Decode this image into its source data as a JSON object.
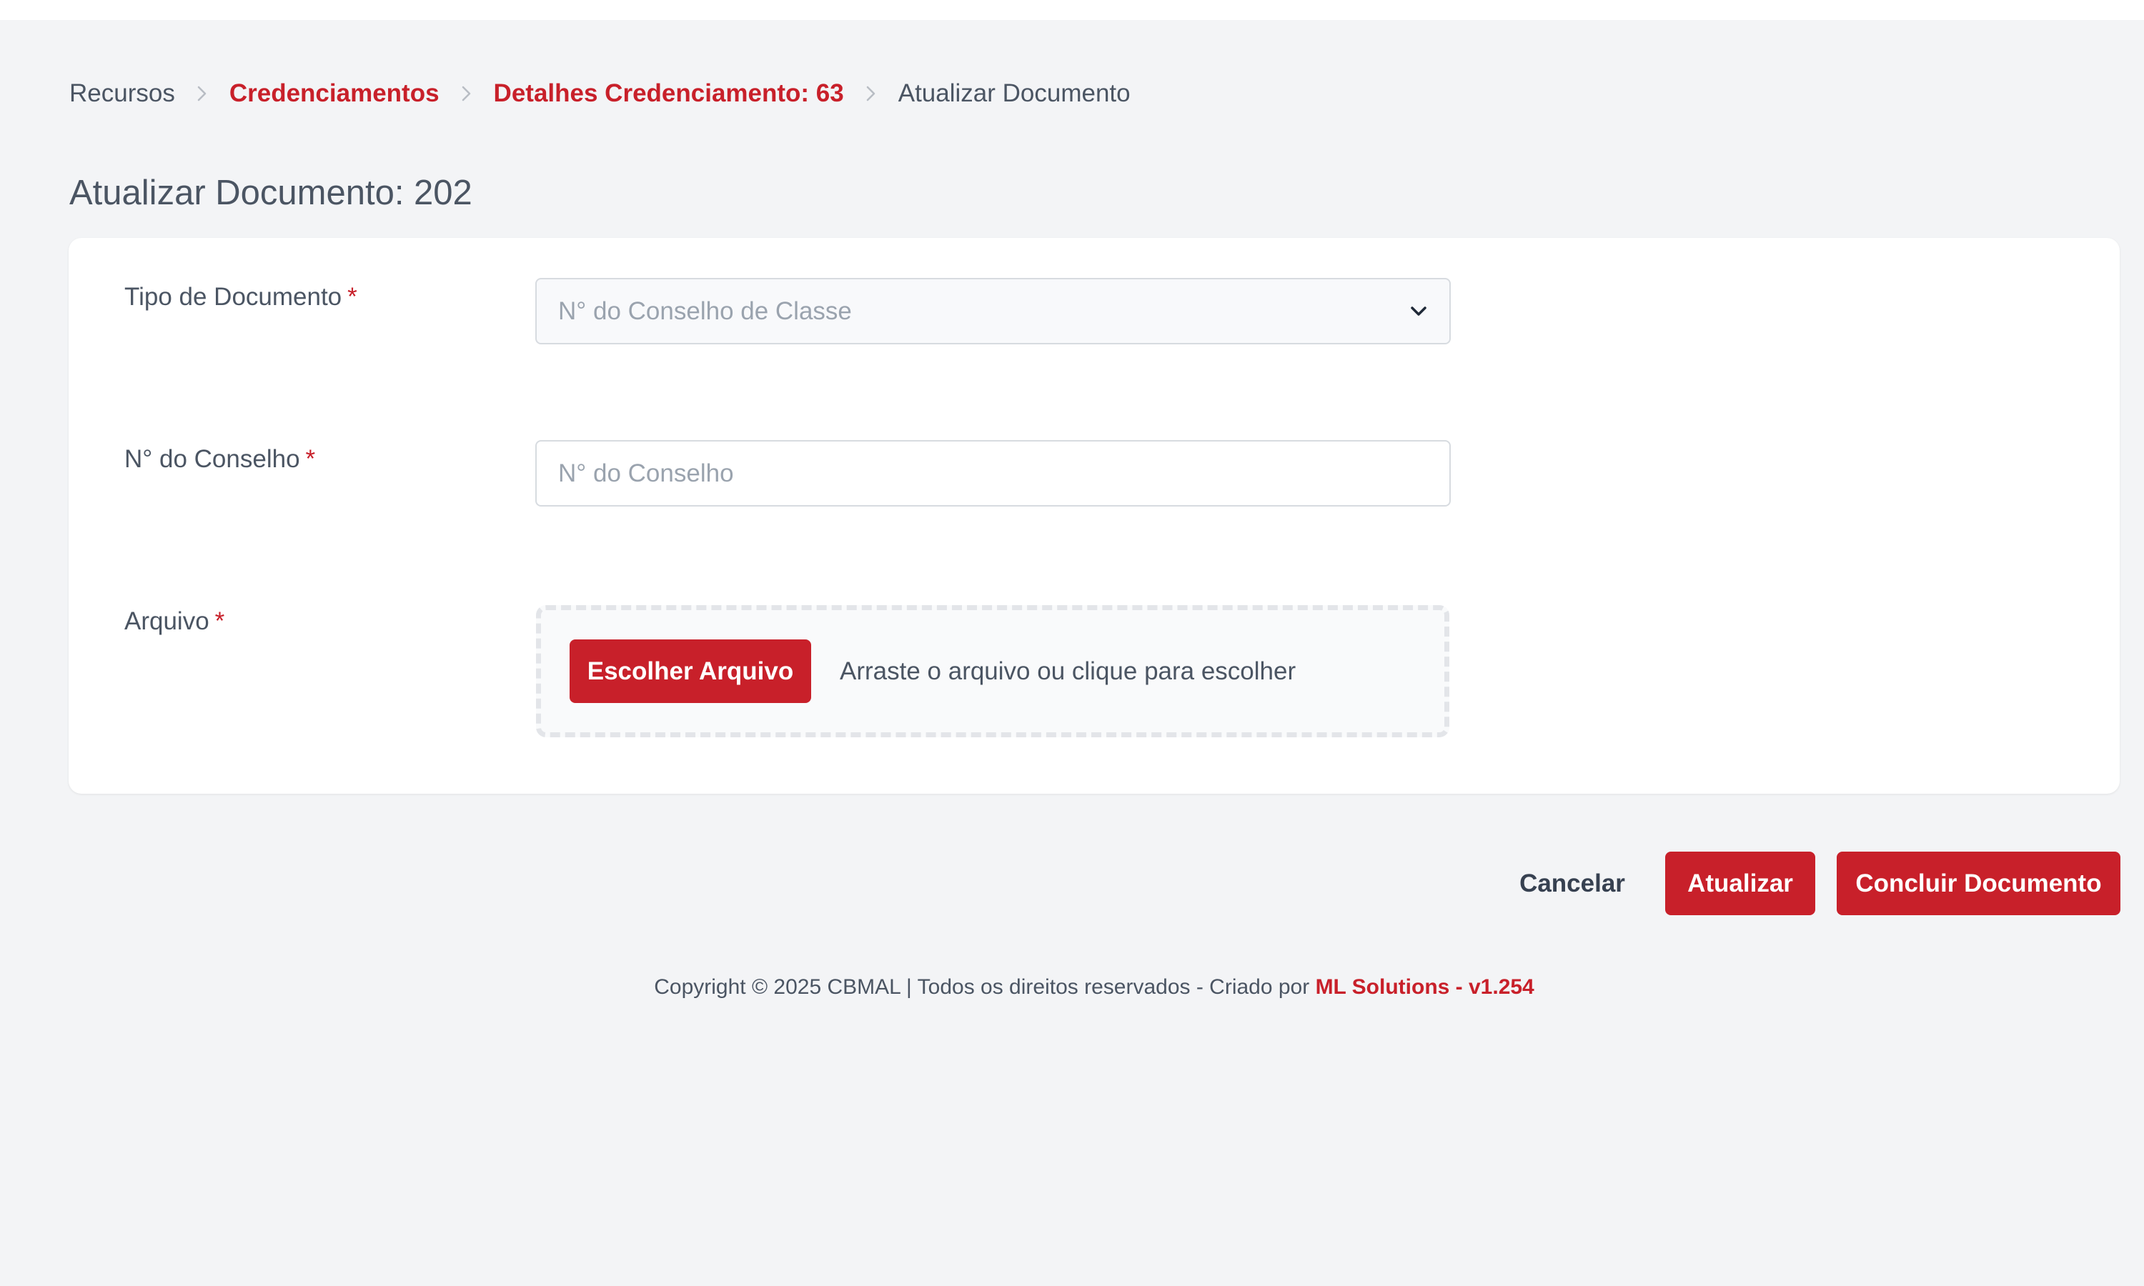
{
  "breadcrumb": {
    "items": [
      {
        "label": "Recursos"
      },
      {
        "label": "Credenciamentos"
      },
      {
        "label": "Detalhes Credenciamento: 63"
      },
      {
        "label": "Atualizar Documento"
      }
    ]
  },
  "page": {
    "title": "Atualizar Documento: 202"
  },
  "form": {
    "required_mark": "*",
    "document_type": {
      "label": "Tipo de Documento",
      "selected": "N° do Conselho de Classe"
    },
    "council_number": {
      "label": "N° do Conselho",
      "placeholder": "N° do Conselho",
      "value": ""
    },
    "file": {
      "label": "Arquivo",
      "button_label": "Escolher Arquivo",
      "hint": "Arraste o arquivo ou clique para escolher"
    }
  },
  "actions": {
    "cancel_label": "Cancelar",
    "update_label": "Atualizar",
    "finish_label": "Concluir Documento"
  },
  "footer": {
    "copyright": "Copyright © 2025 CBMAL | Todos os direitos reservados - Criado por ",
    "link_label": "ML Solutions - v1.254"
  },
  "theme": {
    "accent": "#c8202a",
    "background": "#f3f4f6",
    "card": "#ffffff",
    "text": "#4b5563",
    "placeholder": "#9aa3ae"
  },
  "icons": {
    "breadcrumb_separator": "chevron-right-icon",
    "select_toggle": "chevron-down-icon"
  }
}
